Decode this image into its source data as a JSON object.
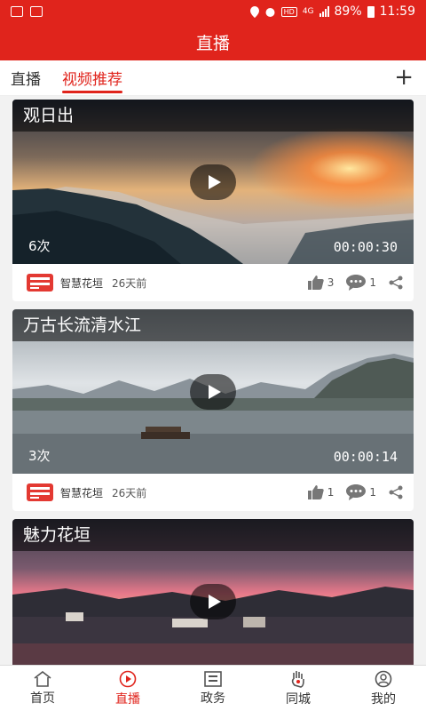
{
  "status_bar": {
    "network": "4G",
    "battery": "89%",
    "time": "11:59",
    "hd": "HD"
  },
  "header": {
    "title": "直播"
  },
  "tabs": [
    {
      "label": "直播",
      "active": false
    },
    {
      "label": "视频推荐",
      "active": true
    }
  ],
  "add_icon": "plus-icon",
  "feed": [
    {
      "title": "观日出",
      "views": "6次",
      "duration": "00:00:30",
      "source": "智慧花垣",
      "age": "26天前",
      "likes": "3",
      "comments": "1"
    },
    {
      "title": "万古长流清水江",
      "views": "3次",
      "duration": "00:00:14",
      "source": "智慧花垣",
      "age": "26天前",
      "likes": "1",
      "comments": "1"
    },
    {
      "title": "魅力花垣",
      "views": "",
      "duration": "",
      "source": "",
      "age": "",
      "likes": "",
      "comments": ""
    }
  ],
  "bottom_nav": [
    {
      "label": "首页",
      "icon": "home-icon",
      "active": false
    },
    {
      "label": "直播",
      "icon": "play-circle-icon",
      "active": true
    },
    {
      "label": "政务",
      "icon": "gov-icon",
      "active": false
    },
    {
      "label": "同城",
      "icon": "hand-icon",
      "active": false
    },
    {
      "label": "我的",
      "icon": "user-icon",
      "active": false
    }
  ],
  "colors": {
    "brand": "#e0241c",
    "nav_active": "#e0241c"
  }
}
